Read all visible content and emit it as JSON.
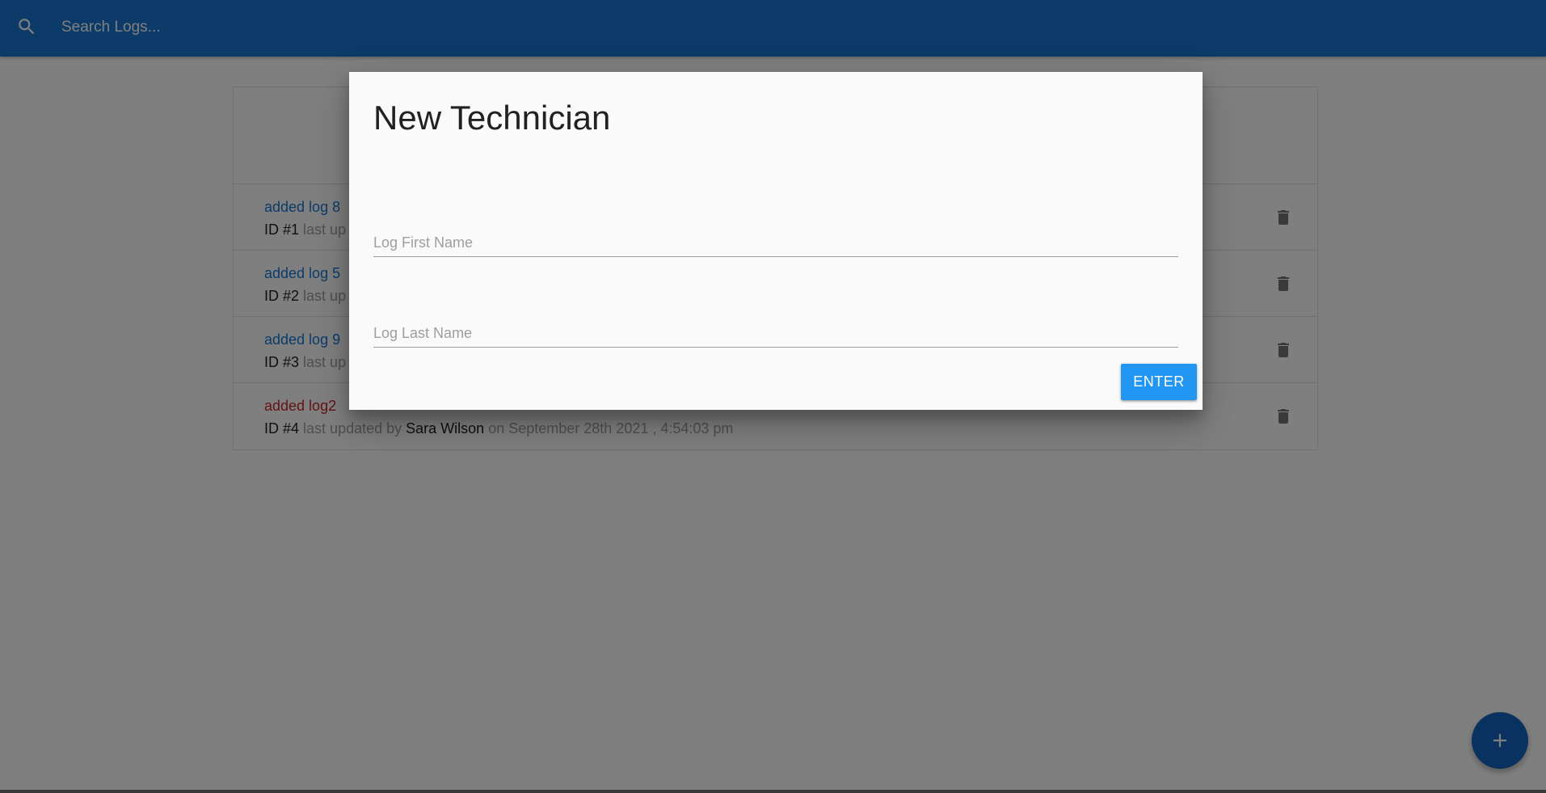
{
  "navbar": {
    "search_placeholder": "Search Logs...",
    "search_icon": "search-icon",
    "color": "#1976d2"
  },
  "logs": [
    {
      "message": "added log 8",
      "attention": false,
      "id_label": "ID #1",
      "meta_prefix": "last up"
    },
    {
      "message": "added log 5",
      "attention": false,
      "id_label": "ID #2",
      "meta_prefix": "last up"
    },
    {
      "message": "added log 9",
      "attention": false,
      "id_label": "ID #3",
      "meta_prefix": "last up"
    },
    {
      "message": "added log2",
      "attention": true,
      "id_label": "ID #4",
      "meta_prefix": "last updated by",
      "tech": "Sara Wilson",
      "date_text": "on September 28th 2021 , 4:54:03 pm"
    }
  ],
  "modal": {
    "title": "New Technician",
    "first_name_placeholder": "Log First Name",
    "first_name_value": "",
    "last_name_placeholder": "Log Last Name",
    "last_name_value": "",
    "enter_label": "ENTER",
    "button_color": "#2196f3"
  },
  "fab": {
    "icon": "plus-icon",
    "color": "#1565c0"
  },
  "icons": {
    "delete": "trash-icon"
  }
}
